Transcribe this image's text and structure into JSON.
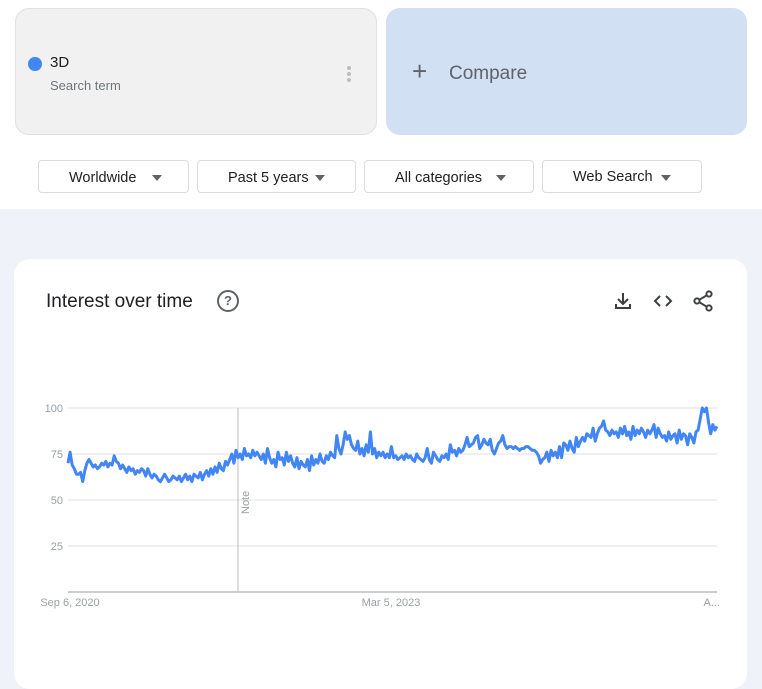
{
  "search_term": {
    "name": "3D",
    "subtitle": "Search term",
    "color": "#4285f4"
  },
  "compare": {
    "label": "Compare"
  },
  "filters": [
    {
      "label": "Worldwide"
    },
    {
      "label": "Past 5 years"
    },
    {
      "label": "All categories"
    },
    {
      "label": "Web Search"
    }
  ],
  "interest_panel": {
    "title": "Interest over time",
    "icons": [
      "help-icon",
      "download-icon",
      "embed-code-icon",
      "share-icon"
    ],
    "note_label": "Note"
  },
  "chart_data": {
    "type": "line",
    "ylim": [
      0,
      100
    ],
    "yticks": [
      "100",
      "75",
      "50",
      "25"
    ],
    "x_tick_labels": [
      "Sep 6, 2020",
      "Mar 5, 2023",
      "A..."
    ],
    "grid": true,
    "line_color": "#4285f4",
    "series": [
      {
        "values": [
          70,
          76,
          69,
          67,
          64,
          64,
          65,
          60,
          66,
          70,
          72,
          70,
          68,
          69,
          67,
          68,
          70,
          69,
          71,
          68,
          70,
          69,
          74,
          71,
          70,
          67,
          69,
          67,
          65,
          68,
          66,
          67,
          64,
          66,
          65,
          67,
          66,
          63,
          67,
          64,
          62,
          64,
          63,
          61,
          60,
          62,
          64,
          62,
          60,
          61,
          63,
          62,
          61,
          63,
          60,
          62,
          64,
          61,
          63,
          60,
          64,
          63,
          62,
          65,
          61,
          64,
          66,
          63,
          67,
          64,
          68,
          65,
          70,
          67,
          66,
          71,
          69,
          72,
          75,
          70,
          77,
          73,
          75,
          72,
          78,
          74,
          75,
          73,
          77,
          74,
          76,
          74,
          72,
          75,
          70,
          78,
          73,
          70,
          72,
          68,
          76,
          72,
          73,
          69,
          76,
          71,
          74,
          70,
          68,
          73,
          67,
          71,
          69,
          68,
          72,
          66,
          74,
          69,
          72,
          70,
          75,
          71,
          70,
          74,
          72,
          76,
          74,
          73,
          85,
          78,
          75,
          80,
          87,
          83,
          85,
          80,
          78,
          77,
          82,
          75,
          78,
          74,
          80,
          76,
          87,
          75,
          78,
          73,
          76,
          74,
          76,
          73,
          75,
          73,
          79,
          73,
          74,
          72,
          73,
          74,
          72,
          75,
          73,
          74,
          72,
          71,
          75,
          73,
          72,
          71,
          73,
          78,
          72,
          70,
          76,
          74,
          72,
          71,
          74,
          73,
          75,
          72,
          80,
          76,
          77,
          74,
          78,
          76,
          77,
          80,
          84,
          79,
          80,
          81,
          84,
          85,
          78,
          80,
          83,
          81,
          80,
          83,
          77,
          75,
          78,
          81,
          82,
          85,
          80,
          78,
          79,
          79,
          78,
          79,
          78,
          77,
          78,
          78,
          79,
          79,
          78,
          77,
          77,
          76,
          74,
          70,
          72,
          73,
          76,
          71,
          77,
          74,
          76,
          73,
          79,
          73,
          81,
          80,
          77,
          82,
          78,
          76,
          84,
          79,
          82,
          84,
          82,
          86,
          85,
          84,
          89,
          82,
          86,
          89,
          90,
          93,
          88,
          87,
          85,
          88,
          86,
          87,
          84,
          89,
          86,
          90,
          85,
          87,
          83,
          90,
          85,
          88,
          86,
          89,
          87,
          84,
          88,
          86,
          88,
          91,
          84,
          89,
          86,
          84,
          85,
          82,
          87,
          83,
          85,
          86,
          81,
          88,
          83,
          86,
          85,
          80,
          86,
          84,
          81,
          87,
          88,
          94,
          100,
          98,
          100,
          92,
          86,
          91,
          88,
          90
        ]
      }
    ]
  }
}
